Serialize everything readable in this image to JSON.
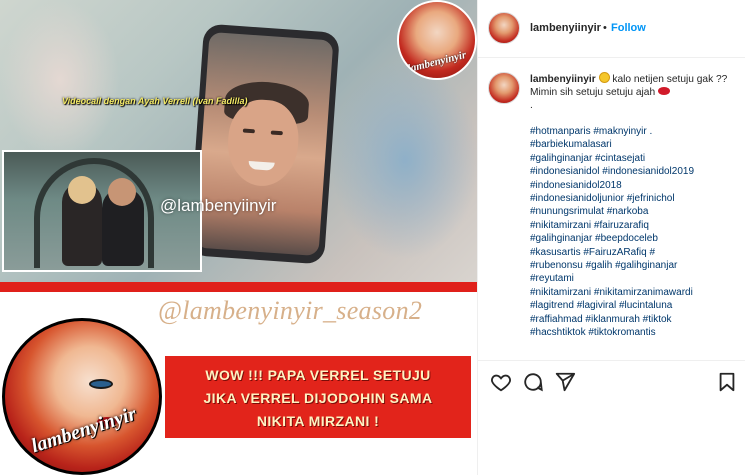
{
  "post_media": {
    "logo_top_text": "lambenyinyir",
    "handle_center": "@lambenyiinyir",
    "inset_caption": "Videocall dengan Ayah Verrell (Ivan Fadilla)",
    "handle_season": "@lambenyinyir_season2",
    "logo_big_text": "lambenyinyir",
    "headline_lines": [
      "WOW !!! PAPA VERREL SETUJU",
      "JIKA VERREL DIJODOHIN SAMA",
      "NIKITA MIRZANI !"
    ]
  },
  "header": {
    "username": "lambenyiinyir",
    "separator": "•",
    "follow_label": "Follow"
  },
  "caption": {
    "username": "lambenyiinyir",
    "text_before_emoji": "",
    "text_after_emoji": " kalo netijen setuju gak ?? Mimin sih setuju setuju ajah ",
    "trailing": ".",
    "emoji_1": "laughing-emoji",
    "emoji_2": "lips-emoji"
  },
  "hashtags": [
    "#hotmanparis #maknyinyir .",
    "#barbiekumalasari",
    "#galihginanjar #cintasejati",
    "#indonesianidol #indonesianidol2019",
    "#indonesianidol2018",
    "#indonesianidoljunior #jefrinichol",
    "#nunungsrimulat #narkoba",
    "#nikitamirzani #fairuzarafiq",
    "#galihginanjar #beepdoceleb",
    "#kasusartis #FairuzARafiq #",
    "#rubenonsu #galih #galihginanjar",
    "#reyutami",
    "#nikitamirzani #nikitamirzanimawardi",
    "#lagitrend #lagiviral #lucintaluna",
    "#raffiahmad #iklanmurah #tiktok",
    "#hacshtiktok #tiktokromantis"
  ],
  "actions": {
    "like_icon": "heart-icon",
    "comment_icon": "comment-icon",
    "share_icon": "share-icon",
    "save_icon": "bookmark-icon"
  },
  "colors": {
    "link_blue": "#0095f6",
    "hashtag": "#00376b",
    "banner_red": "#e2241b"
  }
}
